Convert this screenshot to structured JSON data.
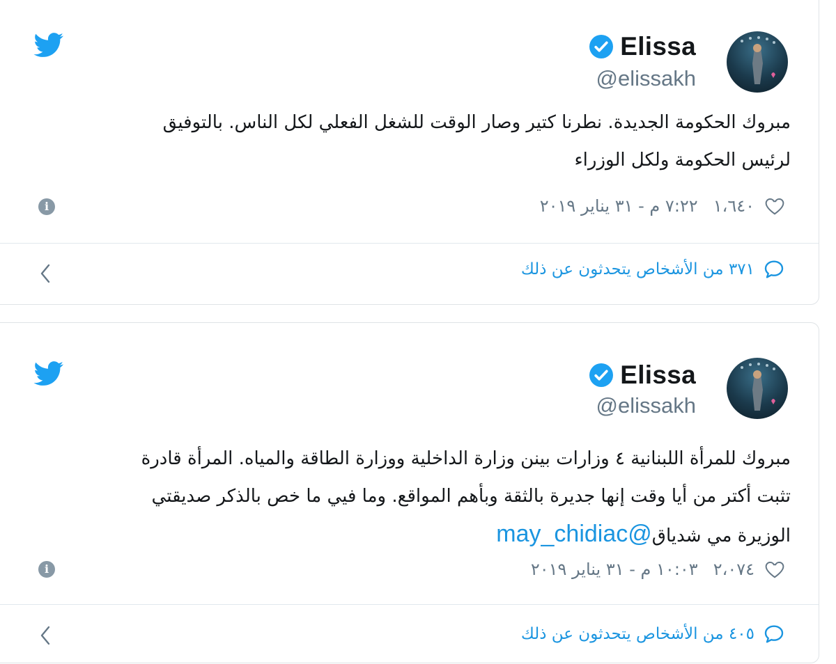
{
  "tweets": [
    {
      "author": {
        "name": "Elissa",
        "handle": "@elissakh"
      },
      "text_lines": [
        "مبروك الحكومة الجديدة. نطرنا كتير وصار الوقت للشغل الفعلي لكل الناس. بالتوفيق",
        "لرئيس الحكومة ولكل الوزراء"
      ],
      "mention": "",
      "likes": "١،٦٤٠",
      "timestamp": "٧:٢٢ م - ٣١ يناير ٢٠١٩",
      "talking": "٣٧١ من الأشخاص يتحدثون عن ذلك"
    },
    {
      "author": {
        "name": "Elissa",
        "handle": "@elissakh"
      },
      "text_lines": [
        "مبروك للمرأة اللبنانية ٤ وزارات بينن وزارة الداخلية ووزارة الطاقة والمياه. المرأة قادرة",
        "تثبت أكتر من أيا وقت إنها جديرة بالثقة وبأهم المواقع. وما فيي ما خص بالذكر صديقتي",
        "الوزيرة مي شدياق"
      ],
      "mention": "@may_chidiac",
      "likes": "٢،٠٧٤",
      "timestamp": "١٠:٠٣ م - ٣١ يناير ٢٠١٩",
      "talking": "٤٠٥ من الأشخاص يتحدثون عن ذلك"
    }
  ],
  "icons": {
    "bird": "twitter-bird-icon",
    "verified": "verified-badge-icon",
    "heart": "heart-icon",
    "info": "info-icon",
    "reply": "reply-bubble-icon",
    "chevron": "chevron-left-icon"
  },
  "colors": {
    "twitter_blue": "#1da1f2",
    "link_blue": "#1b95e0",
    "muted": "#657786"
  },
  "info_glyph": "i"
}
